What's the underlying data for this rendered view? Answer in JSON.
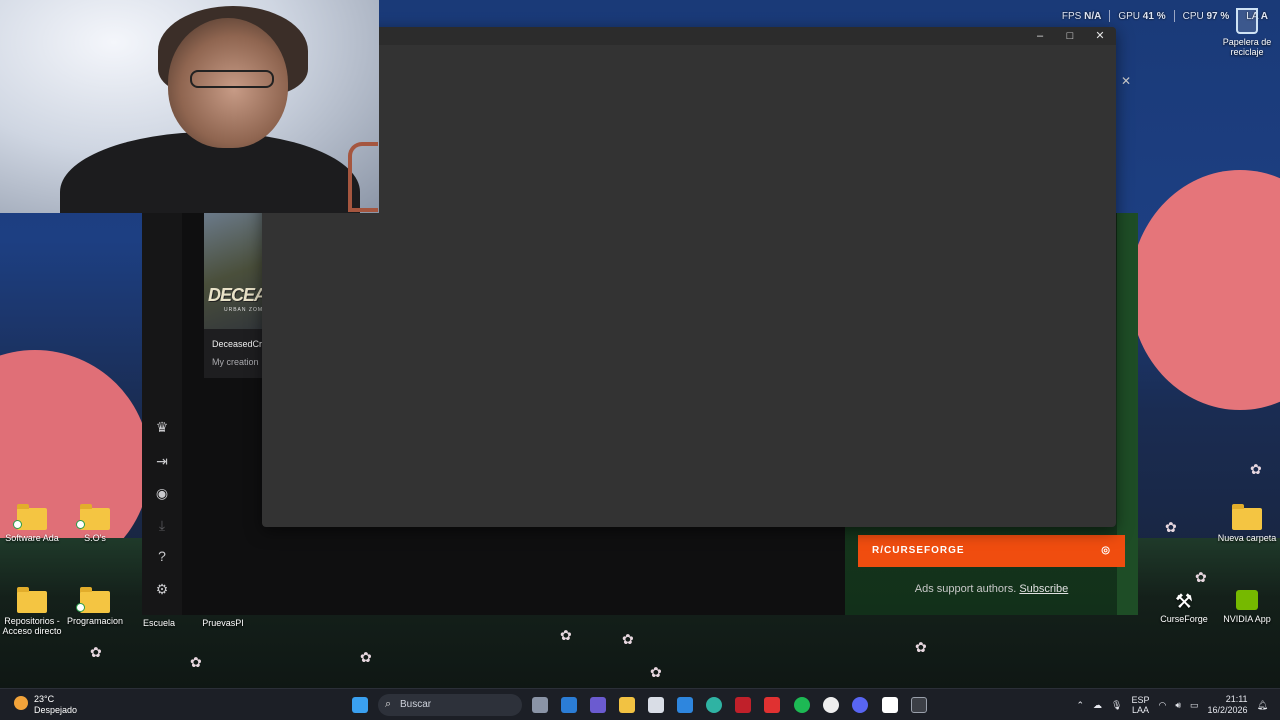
{
  "hud": {
    "fps_label": "FPS",
    "fps_value": "N/A",
    "gpu_label": "GPU",
    "gpu_value": "41 %",
    "cpu_label": "CPU",
    "cpu_value": "97 %",
    "lat_label": "LA",
    "lat_value": "A"
  },
  "desktop_icons": {
    "recycle": "Papelera de reciclaje",
    "software": "Software Ada",
    "so": "S.O's",
    "repos": "Repositorios - Acceso directo",
    "programacion": "Programacion",
    "escuela": "Escuela",
    "pruevas": "PruevasPI",
    "nueva": "Nueva carpeta",
    "curseforge": "CurseForge",
    "nvidia": "NVIDIA App"
  },
  "app": {
    "card_title": "DeceasedCr",
    "card_desc": "My creation",
    "card_logo": "DECEASE",
    "card_logo_sub": "URBAN ZOMBIE",
    "reddit_label": "R/CURSEFORGE",
    "ads_text": "Ads support authors.",
    "subscribe_link": "Subscribe"
  },
  "window": {
    "minimize": "–",
    "maximize": "□",
    "close": "✕"
  },
  "taskbar": {
    "weather_temp": "23°C",
    "weather_desc": "Despejado",
    "search_placeholder": "Buscar",
    "lang_top": "ESP",
    "lang_bottom": "LAA",
    "time": "21:11",
    "date": "16/2/2026"
  },
  "colors": {
    "reddit": "#f04d0f",
    "window_bg": "#333333",
    "app_bg": "#0f0f10"
  }
}
